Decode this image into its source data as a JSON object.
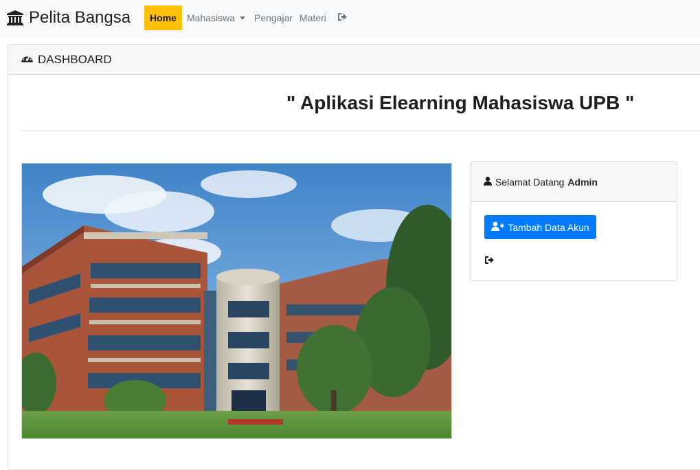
{
  "navbar": {
    "brand": "Pelita Bangsa",
    "brand_icon": "university-icon",
    "items": [
      {
        "label": "Home",
        "active": true
      },
      {
        "label": "Mahasiswa",
        "dropdown": true
      },
      {
        "label": "Pengajar"
      },
      {
        "label": "Materi"
      }
    ],
    "logout_icon": "sign-out-icon",
    "accent_color": "#ffc107"
  },
  "card": {
    "header_icon": "tachometer-icon",
    "header": "DASHBOARD"
  },
  "main": {
    "heading": "\" Aplikasi Elearning Mahasiswa UPB \""
  },
  "welcome_panel": {
    "user_icon": "user-icon",
    "greeting": "Selamat Datang",
    "username": "Admin",
    "add_button": {
      "label": "Tambah Data Akun",
      "icon": "user-plus-icon",
      "color": "#007bff"
    },
    "logout_icon": "sign-out-icon"
  }
}
